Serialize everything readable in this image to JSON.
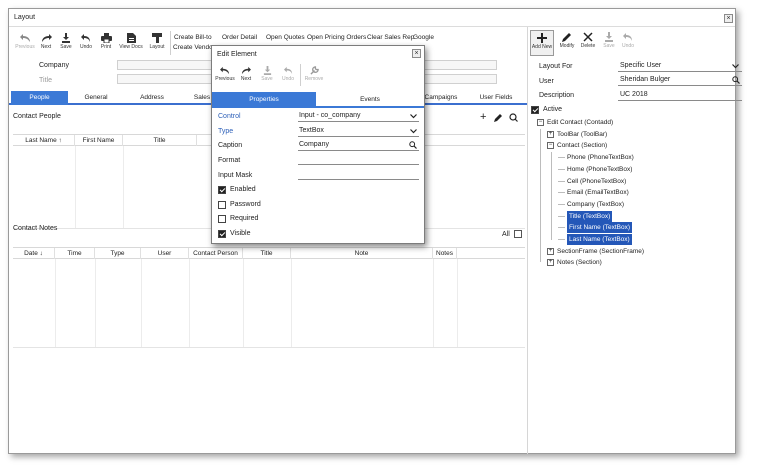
{
  "window": {
    "title": "Layout",
    "close": "×"
  },
  "toolbar": {
    "previous": "Previous",
    "next": "Next",
    "save": "Save",
    "undo": "Undo",
    "print": "Print",
    "view_docs": "View Docs",
    "layout": "Layout"
  },
  "links": {
    "create_billto": "Create Bill-to",
    "create_vendor": "Create Vendor",
    "order_detail": "Order Detail",
    "open_quotes": "Open Quotes",
    "open_pricing": "Open Pricing Orders",
    "clear_sales_rep": "Clear Sales Rep",
    "google": "Google"
  },
  "form": {
    "company_label": "Company",
    "title_label": "Title"
  },
  "tabs": [
    "People",
    "General",
    "Address",
    "Sales",
    "Campaigns",
    "User Fields"
  ],
  "contact_people": {
    "title": "Contact People",
    "columns": [
      "Last Name ↑",
      "First Name",
      "Title"
    ]
  },
  "contact_notes": {
    "title": "Contact Notes",
    "all_label": "All",
    "columns": [
      "Date ↓",
      "Time",
      "Type",
      "User",
      "Contact Person",
      "Title",
      "Note",
      "Notes"
    ]
  },
  "dialog": {
    "title": "Edit Element",
    "close": "×",
    "toolbar": {
      "previous": "Previous",
      "next": "Next",
      "save": "Save",
      "undo": "Undo",
      "remove": "Remove"
    },
    "tabs": {
      "properties": "Properties",
      "events": "Events"
    },
    "fields": {
      "control_label": "Control",
      "control_value": "Input - co_company",
      "type_label": "Type",
      "type_value": "TextBox",
      "caption_label": "Caption",
      "caption_value": "Company",
      "format_label": "Format",
      "format_value": "",
      "input_mask_label": "Input Mask",
      "input_mask_value": ""
    },
    "checks": [
      {
        "label": "Enabled",
        "checked": true
      },
      {
        "label": "Password",
        "checked": false
      },
      {
        "label": "Required",
        "checked": false
      },
      {
        "label": "Visible",
        "checked": true
      }
    ]
  },
  "right_toolbar": {
    "add_new": "Add New",
    "modify": "Modify",
    "delete": "Delete",
    "save": "Save",
    "undo": "Undo"
  },
  "right_panel": {
    "layout_for_label": "Layout For",
    "layout_for_value": "Specific User",
    "user_label": "User",
    "user_value": "Sheridan Bulger",
    "description_label": "Description",
    "description_value": "UC 2018",
    "active_label": "Active"
  },
  "tree": [
    {
      "label": "Edit Contact (Contadd)",
      "exp": "−",
      "level": 0
    },
    {
      "label": "ToolBar (ToolBar)",
      "exp": "+",
      "level": 1
    },
    {
      "label": "Contact (Section)",
      "exp": "−",
      "level": 1
    },
    {
      "label": "Phone (PhoneTextBox)",
      "level": 2
    },
    {
      "label": "Home (PhoneTextBox)",
      "level": 2
    },
    {
      "label": "Cell (PhoneTextBox)",
      "level": 2
    },
    {
      "label": "Email (EmailTextBox)",
      "level": 2
    },
    {
      "label": "Company (TextBox)",
      "level": 2
    },
    {
      "label": "Title (TextBox)",
      "level": 2,
      "selected": true
    },
    {
      "label": "First Name (TextBox)",
      "level": 2,
      "selected": true
    },
    {
      "label": "Last Name (TextBox)",
      "level": 2,
      "selected": true
    },
    {
      "label": "SectionFrame (SectionFrame)",
      "exp": "+",
      "level": 1
    },
    {
      "label": "Notes (Section)",
      "exp": "+",
      "level": 1
    }
  ],
  "colors": {
    "accent": "#3b79d6",
    "selection": "#2457b8"
  }
}
